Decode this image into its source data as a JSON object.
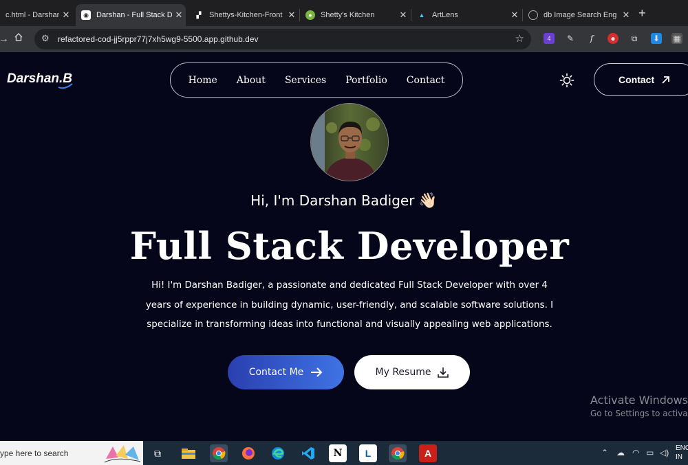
{
  "browser": {
    "tabs": [
      {
        "title": "c.html - Darshan",
        "active": false
      },
      {
        "title": "Darshan - Full Stack D",
        "active": true
      },
      {
        "title": "Shettys-Kitchen-Front",
        "active": false
      },
      {
        "title": "Shetty's Kitchen",
        "active": false
      },
      {
        "title": "ArtLens",
        "active": false
      },
      {
        "title": "db Image Search Eng",
        "active": false
      }
    ],
    "new_tab": "+",
    "url": "refactored-cod-jj5rppr77j7xh5wg9-5500.app.github.dev",
    "extension_badge": "4"
  },
  "page": {
    "logo": "Darshan.B",
    "nav": [
      "Home",
      "About",
      "Services",
      "Portfolio",
      "Contact"
    ],
    "contact_button": "Contact",
    "greeting": "Hi, I'm Darshan Badiger",
    "greeting_emoji": "👋🏻",
    "headline": "Full Stack Developer",
    "bio": "Hi! I'm Darshan Badiger, a passionate and dedicated Full Stack Developer with over 4 years of experience in building dynamic, user-friendly, and scalable software solutions. I specialize in transforming ideas into functional and visually appealing web applications.",
    "primary_button": "Contact Me",
    "secondary_button": "My Resume",
    "colors": {
      "background": "#06061a",
      "primary_gradient_start": "#2a3fb0",
      "primary_gradient_end": "#3f73e5"
    }
  },
  "watermark": {
    "line1": "Activate Windows",
    "line2": "Go to Settings to activate Windows."
  },
  "taskbar": {
    "search_placeholder": "ype here to search",
    "lang": "ENG",
    "region": "IN"
  }
}
